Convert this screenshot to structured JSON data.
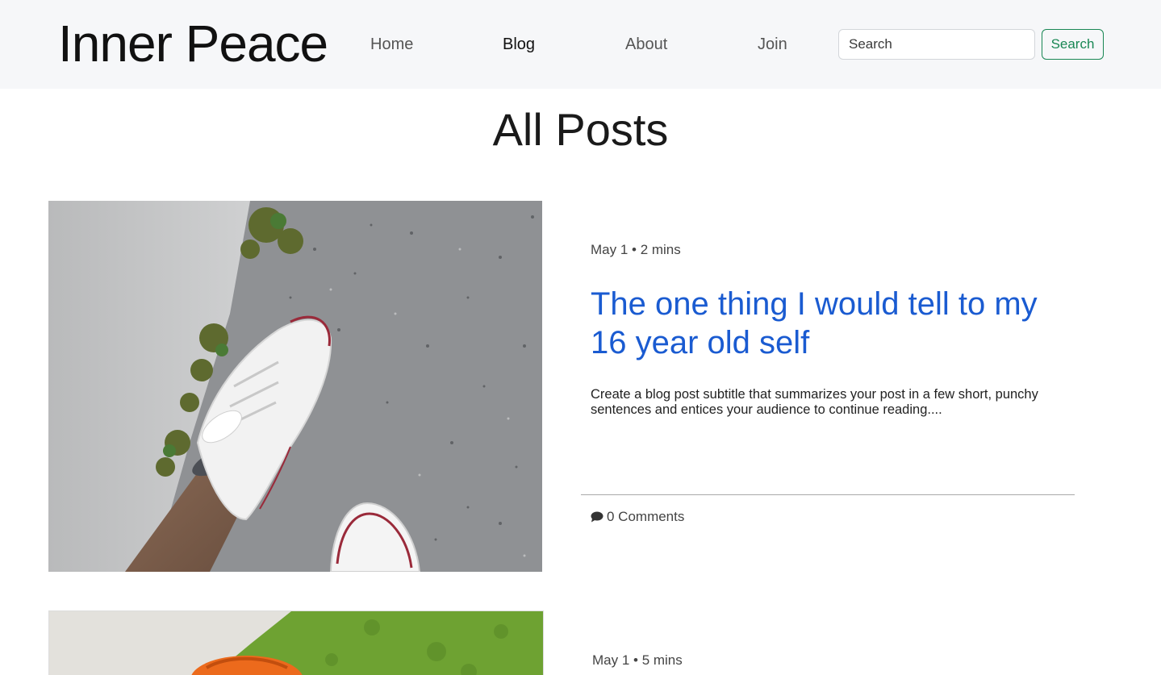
{
  "header": {
    "brand": "Inner Peace",
    "nav": {
      "home": "Home",
      "blog": "Blog",
      "about": "About",
      "join": "Join"
    },
    "search": {
      "placeholder": "Search",
      "button_label": "Search"
    }
  },
  "main": {
    "title": "All Posts",
    "posts": [
      {
        "meta": "May 1 • 2 mins",
        "title": "The one thing I would tell to my 16 year old self",
        "subtitle": "Create a blog post subtitle that summarizes your post in a few short, punchy sentences and entices your audience to continue reading....",
        "comments": "0 Comments",
        "comment_icon": "comment-icon",
        "image": "photo-white-sneaker-on-concrete"
      },
      {
        "meta": "May 1 • 5 mins",
        "image": "photo-orange-object-on-grass"
      }
    ]
  },
  "colors": {
    "nav_bg": "#f6f7f9",
    "link_blue": "#1a5bd1",
    "search_green": "#198754"
  }
}
